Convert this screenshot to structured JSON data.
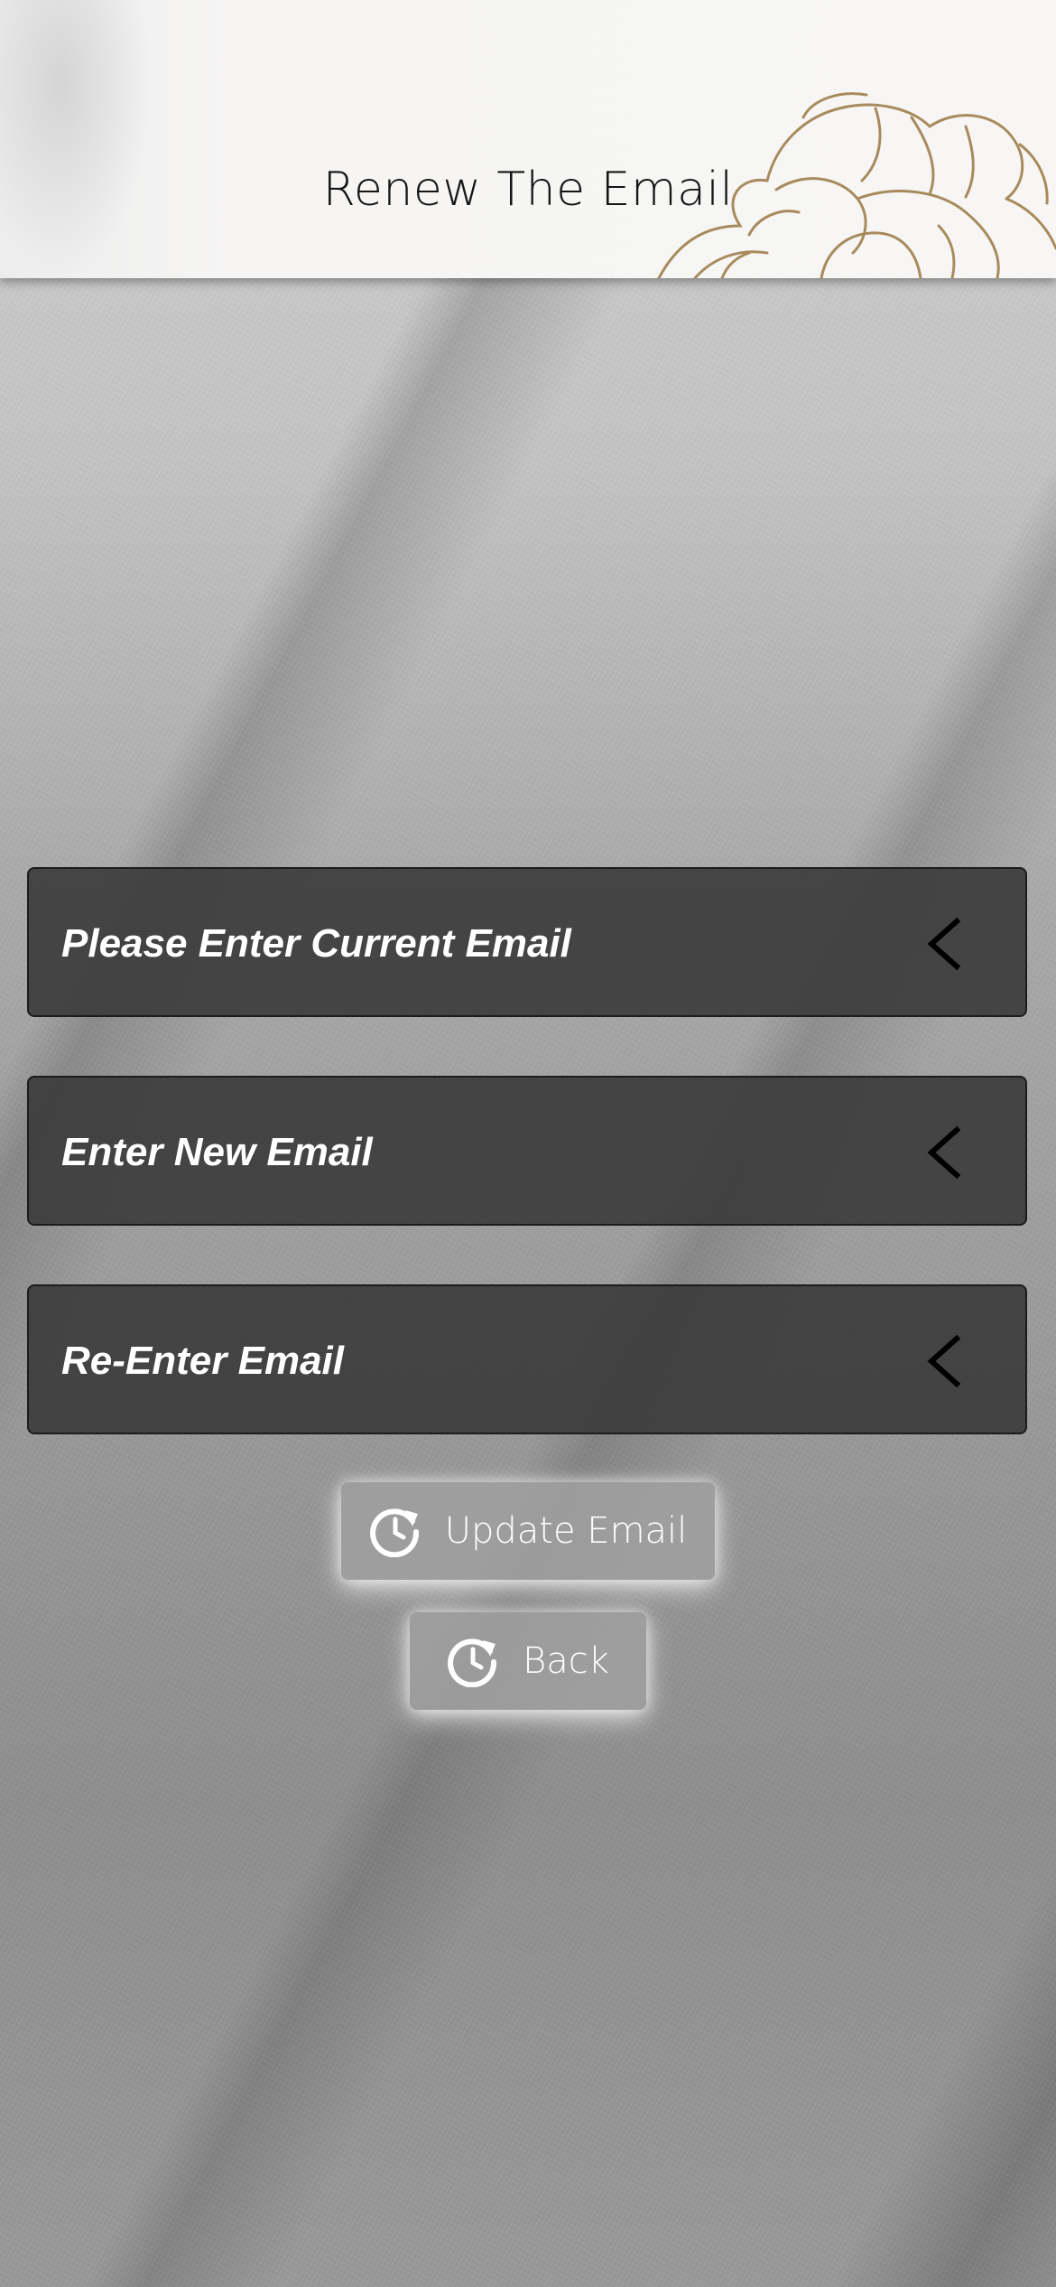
{
  "header": {
    "title": "Renew The Email"
  },
  "form": {
    "fields": [
      {
        "label": "Please Enter Current Email",
        "icon": "chevron-left-icon"
      },
      {
        "label": "Enter New Email",
        "icon": "chevron-left-icon"
      },
      {
        "label": "Re-Enter Email",
        "icon": "chevron-left-icon"
      }
    ]
  },
  "actions": {
    "update_label": "Update Email",
    "update_icon": "refresh-clock-icon",
    "back_label": "Back",
    "back_icon": "refresh-clock-icon"
  },
  "colors": {
    "header_bg": "#f7f6f5",
    "field_bg": "#3a3a3a",
    "button_bg": "#a0a0a0",
    "floral_gold": "#a88b5c",
    "text_light": "#ffffff"
  }
}
